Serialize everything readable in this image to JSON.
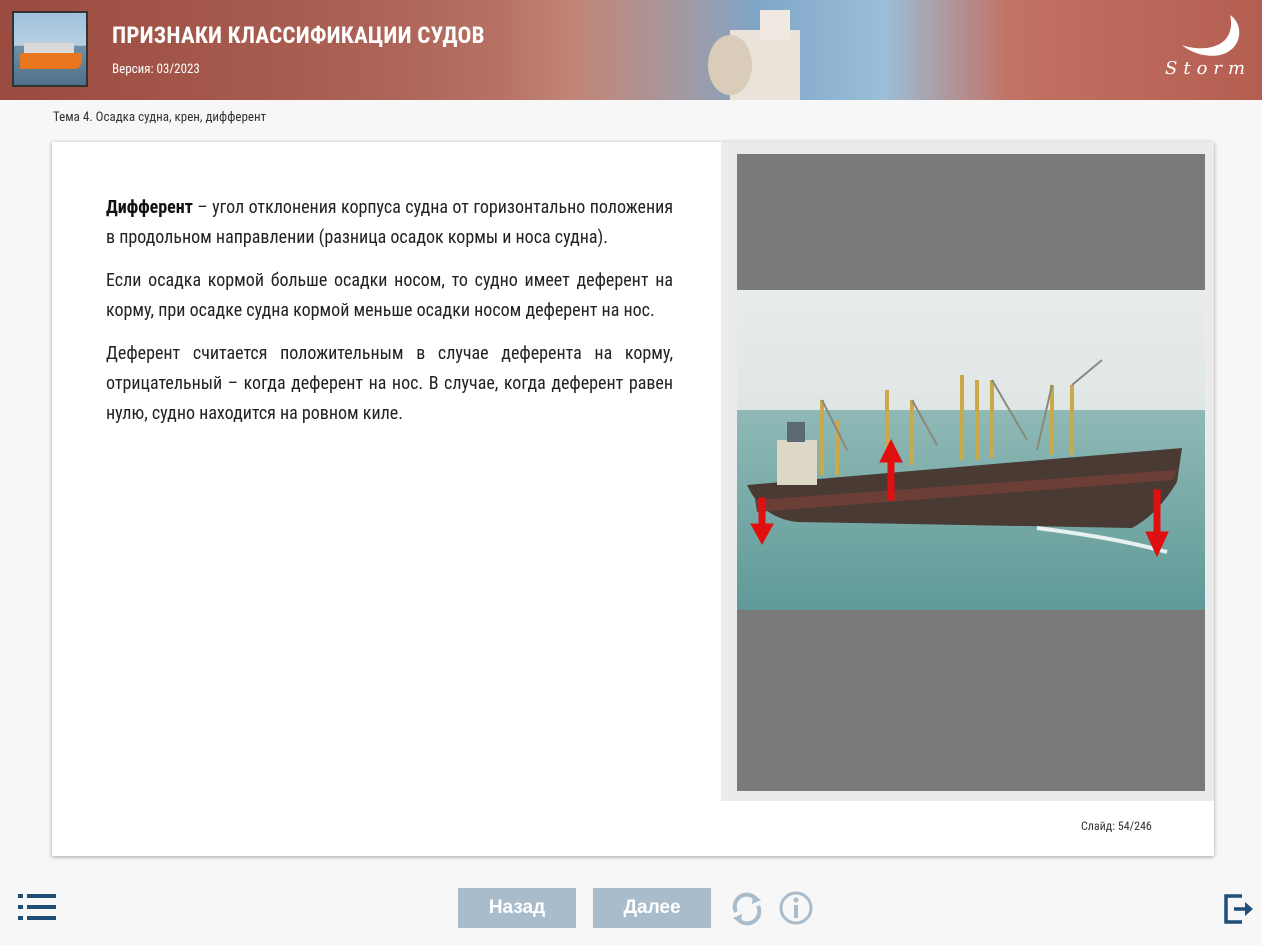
{
  "header": {
    "title": "ПРИЗНАКИ КЛАССИФИКАЦИИ СУДОВ",
    "version": "Версия: 03/2023",
    "logo_text": "Storm"
  },
  "topic": "Тема 4. Осадка судна, крен, дифферент",
  "content": {
    "term": "Дифферент",
    "p1_rest": " – угол отклонения корпуса судна от горизонтально положения в продольном направлении (разница осадок кормы и носа судна).",
    "p2": "Если осадка кормой больше осадки носом, то судно имеет деферент на корму, при осадке судна кормой меньше осадки носом деферент на нос.",
    "p3": "Деферент считается положительным в случае деферента на корму, отрицательный – когда деферент на нос. В случае, когда деферент равен нулю, судно находится на ровном киле."
  },
  "slide_counter": "Слайд:  54/246",
  "footer": {
    "back_label": "Назад",
    "next_label": "Далее"
  },
  "colors": {
    "nav_button": "#a8bccb",
    "icon": "#1f4e79",
    "arrow": "#e01010"
  },
  "icons": [
    "menu-icon",
    "refresh-icon",
    "info-icon",
    "exit-icon"
  ]
}
